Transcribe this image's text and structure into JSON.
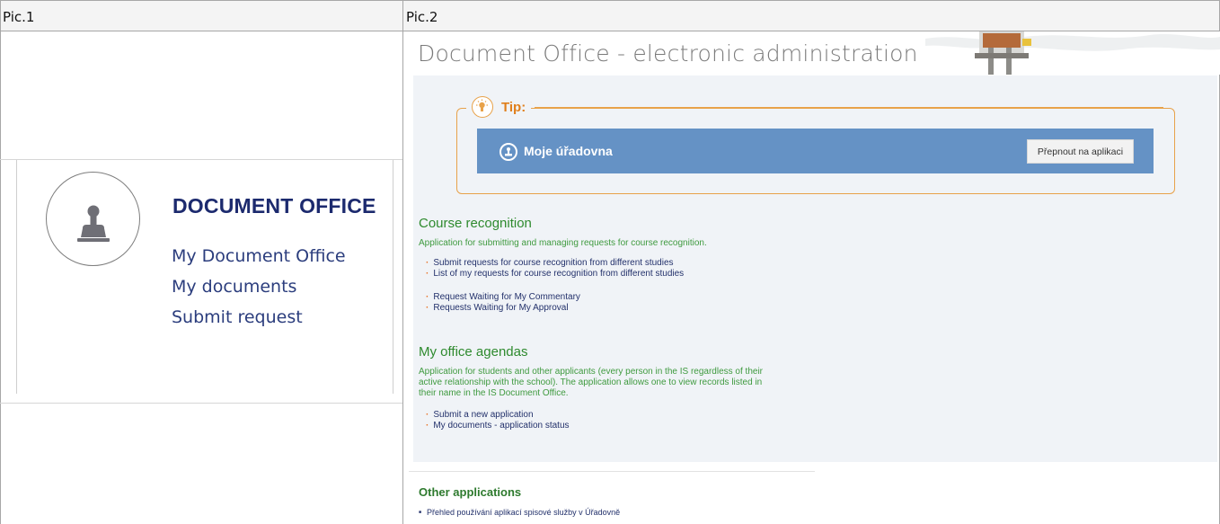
{
  "table": {
    "col1_header": "Pic.1",
    "col2_header": "Pic.2"
  },
  "pic1": {
    "title": "DOCUMENT OFFICE",
    "links": [
      "My Document Office",
      "My documents",
      "Submit request"
    ],
    "icon": "stamp-icon"
  },
  "pic2": {
    "page_title": "Document Office - electronic administration",
    "tip": {
      "label": "Tip:",
      "icon": "lightbulb-icon",
      "app_name": "Moje úřadovna",
      "app_icon": "user-stamp-icon",
      "switch_button": "Přepnout na aplikaci"
    },
    "course_recognition": {
      "heading": "Course recognition",
      "description": "Application for submitting and managing requests for course recognition.",
      "links": [
        "Submit requests for course recognition from different studies",
        "List of my requests for course recognition from different studies",
        "Request Waiting for My Commentary",
        "Requests Waiting for My Approval"
      ]
    },
    "office_agendas": {
      "heading": "My office agendas",
      "description_lines": [
        "Application for students and other applicants (every person in the IS regardless of their",
        "active relationship with the school). The application allows one to view records listed in",
        "their name in the IS Document Office."
      ],
      "links": [
        "Submit a new application",
        "My documents - application status"
      ]
    },
    "other": {
      "heading": "Other applications",
      "links": [
        "Přehled používání aplikací spisové služby v Úřadovně"
      ]
    }
  },
  "colors": {
    "accent_orange": "#e8a24a",
    "bar_blue": "#6592c5",
    "heading_green": "#2e8a2e",
    "link_navy": "#23316b"
  }
}
